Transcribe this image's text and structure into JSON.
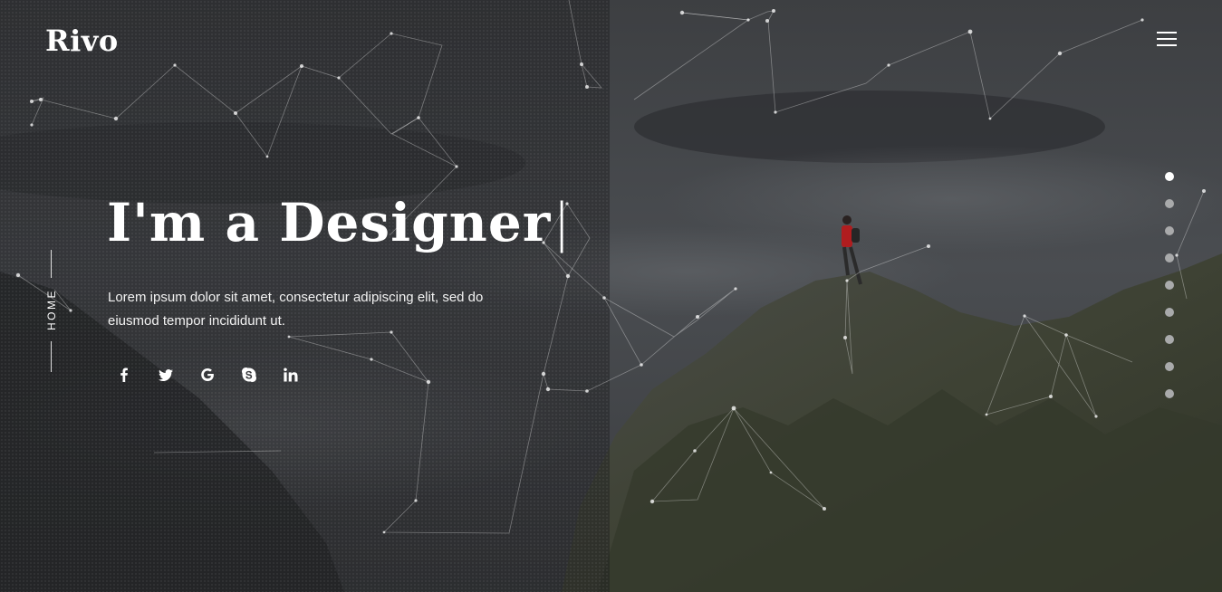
{
  "brand": {
    "logo_text": "Rivo"
  },
  "header": {
    "menu_icon": "hamburger-menu-icon"
  },
  "side_nav": {
    "label": "HOME"
  },
  "hero": {
    "headline": "I'm a Designer",
    "cursor": "|",
    "description": "Lorem ipsum dolor sit amet, consectetur adipiscing elit, sed do eiusmod tempor incididunt ut."
  },
  "socials": [
    {
      "name": "facebook",
      "icon": "facebook-icon"
    },
    {
      "name": "twitter",
      "icon": "twitter-icon"
    },
    {
      "name": "google",
      "icon": "google-icon"
    },
    {
      "name": "skype",
      "icon": "skype-icon"
    },
    {
      "name": "linkedin",
      "icon": "linkedin-icon"
    }
  ],
  "slide_dots": {
    "count": 9,
    "active_index": 0
  },
  "colors": {
    "text": "#ffffff",
    "dot_inactive": "#a9aaab",
    "dot_active": "#ffffff",
    "overlay": "#1c1d1f"
  }
}
